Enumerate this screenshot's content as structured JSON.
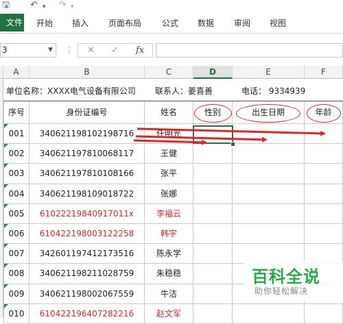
{
  "quick_access": {
    "save_icon": "save-icon",
    "undo_icon": "undo-icon",
    "redo_icon": "redo-icon"
  },
  "ribbon": {
    "file": "文件",
    "tabs": [
      "开始",
      "插入",
      "页面布局",
      "公式",
      "数据",
      "审阅",
      "视图"
    ]
  },
  "formula_bar": {
    "name_box": "3",
    "cancel": "✕",
    "enter": "✓",
    "fx": "fx",
    "value": ""
  },
  "columns": [
    "A",
    "B",
    "C",
    "D",
    "E",
    "F"
  ],
  "info_row": {
    "unit": "单位名称：XXXX电气设备有限公司",
    "contact": "联系人：姜喜善",
    "phone": "电话：  9334939"
  },
  "headers": [
    "序号",
    "身份证编号",
    "姓名",
    "性别",
    "出生日期",
    "年龄"
  ],
  "rows": [
    {
      "no": "001",
      "id": "340621198102198716",
      "name": "任明光",
      "red": false
    },
    {
      "no": "002",
      "id": "340621197810068117",
      "name": "王健",
      "red": false
    },
    {
      "no": "003",
      "id": "340621197810108166",
      "name": "张平",
      "red": false
    },
    {
      "no": "004",
      "id": "340621198109018722",
      "name": "张娜",
      "red": false
    },
    {
      "no": "005",
      "id": "61022219840917011x",
      "name": "李福云",
      "red": true
    },
    {
      "no": "006",
      "id": "610422198003122258",
      "name": "韩宇",
      "red": true
    },
    {
      "no": "007",
      "id": "342601197412173516",
      "name": "陈永学",
      "red": false
    },
    {
      "no": "008",
      "id": "340621198211028759",
      "name": "朱稳稳",
      "red": false
    },
    {
      "no": "009",
      "id": "340621198002067559",
      "name": "牛洁",
      "red": false
    },
    {
      "no": "010",
      "id": "610422196407282216",
      "name": "赵文军",
      "red": true
    }
  ],
  "colors": {
    "accent": "#217346",
    "annotation": "#e02525",
    "red_text": "#d42a2a",
    "watermark": "#2ba84a"
  },
  "watermark": {
    "title": "百科全说",
    "subtitle": "助你轻松解决"
  }
}
